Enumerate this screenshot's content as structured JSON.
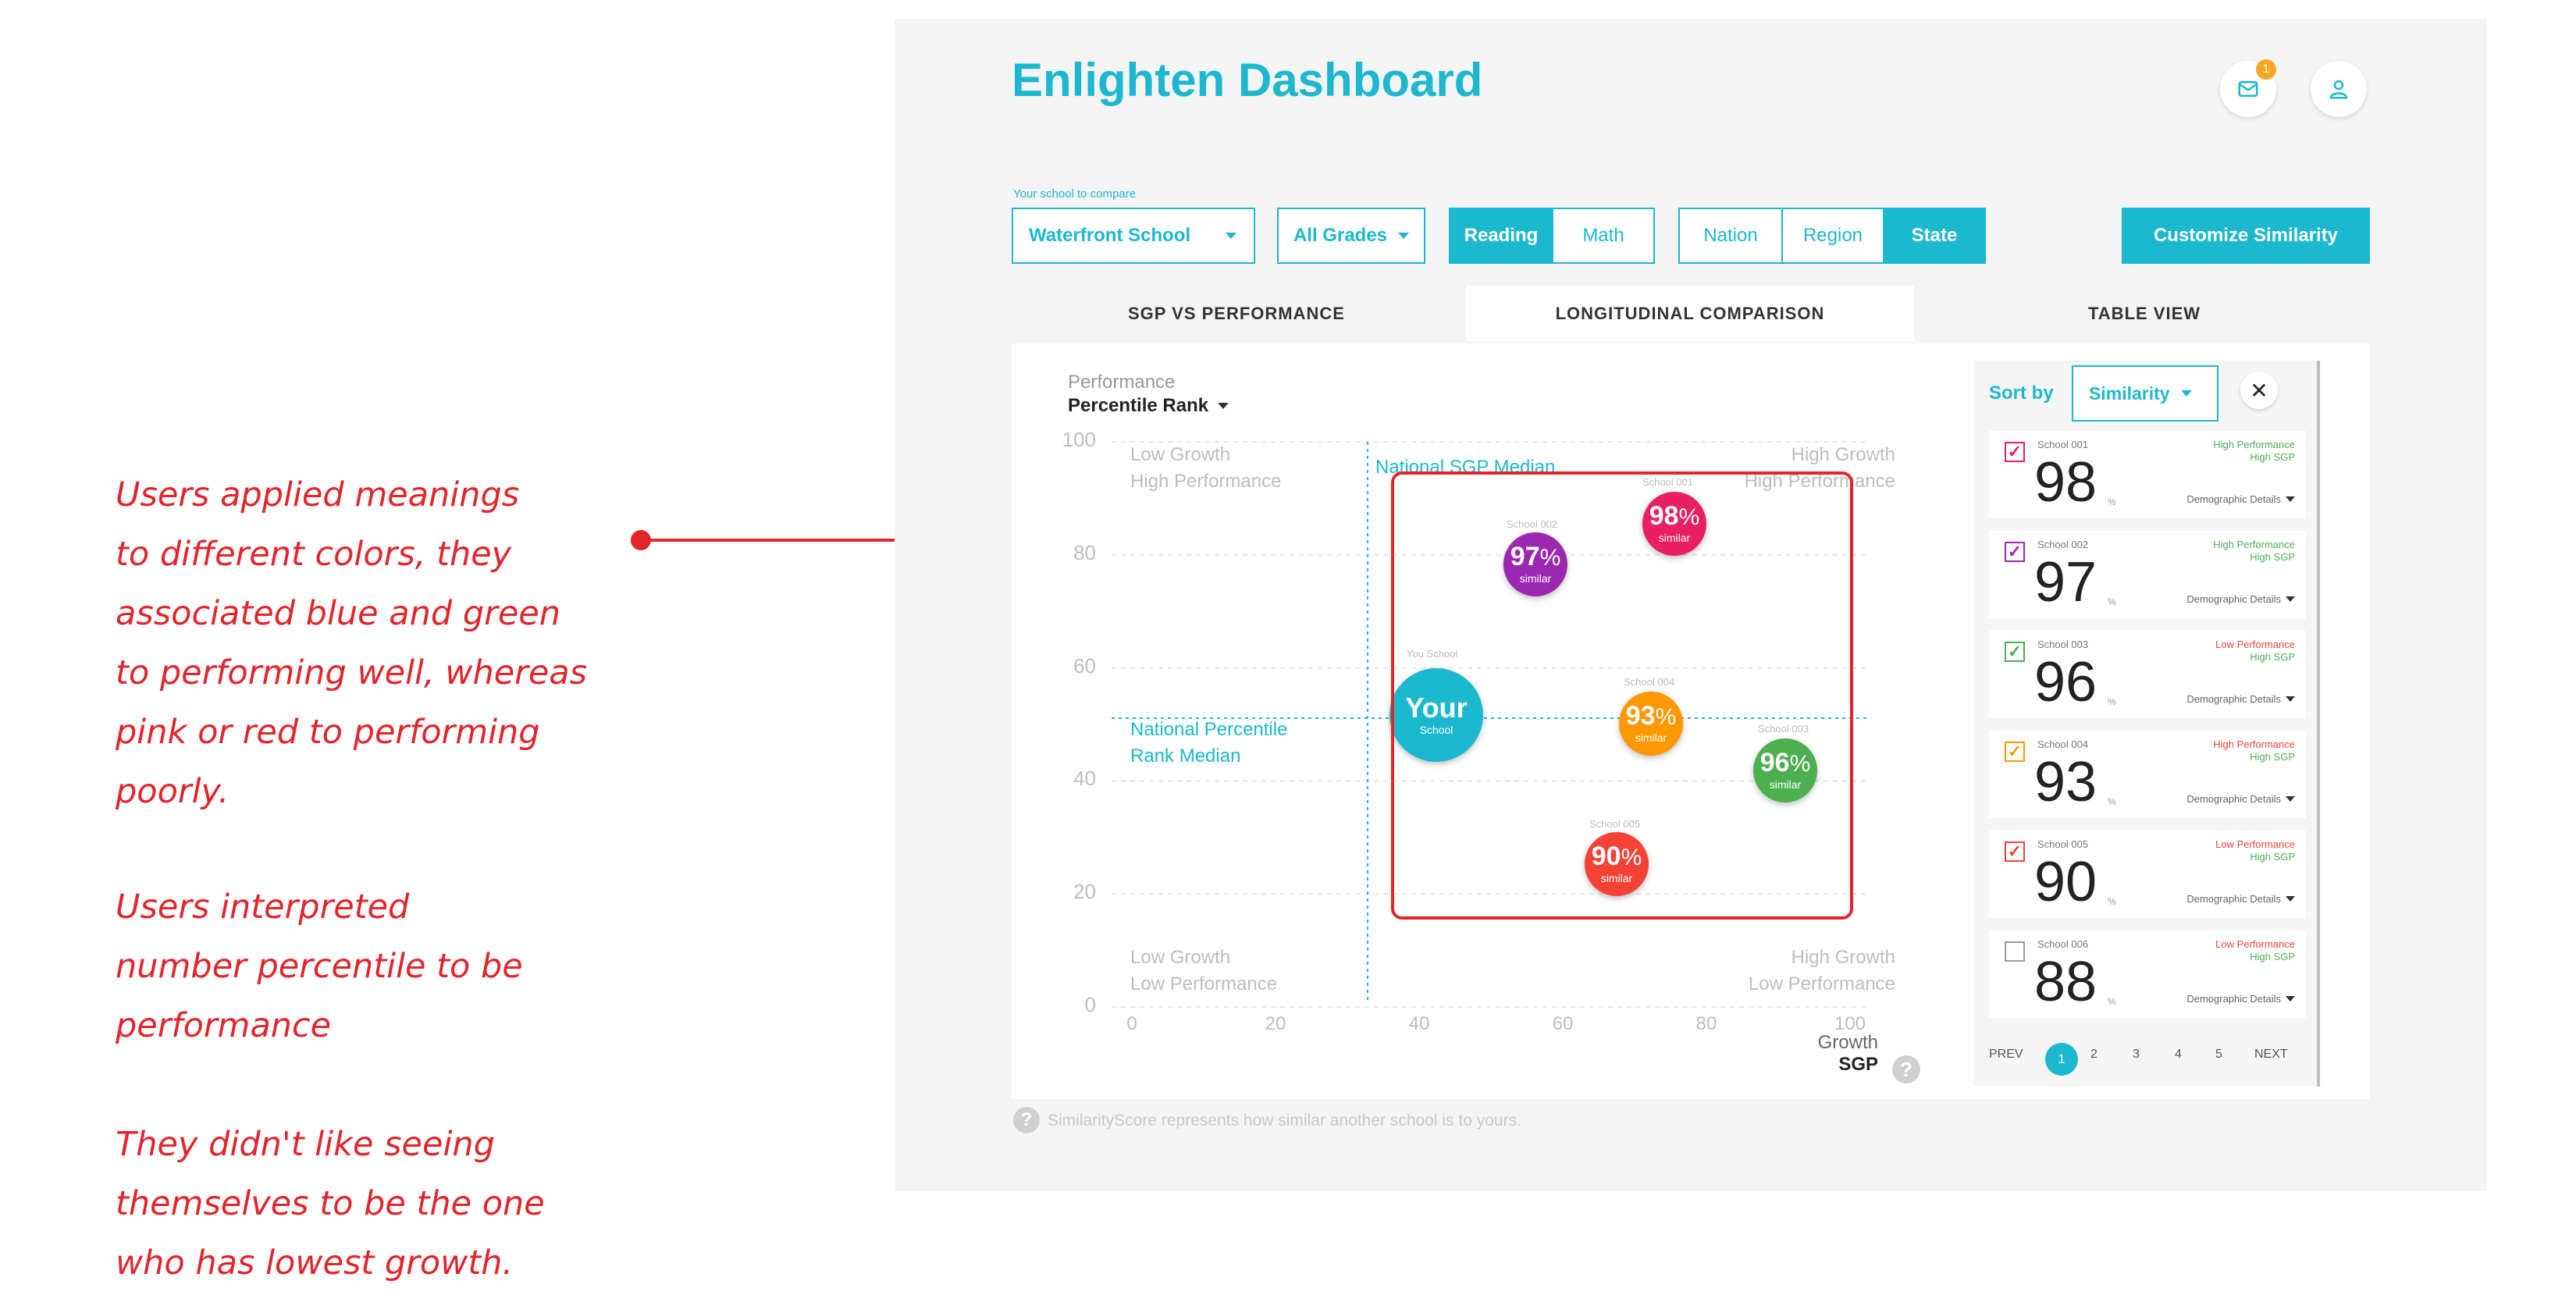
{
  "annotations": {
    "paragraph1": [
      "Users applied meanings",
      "to different colors, they",
      "associated blue and green",
      "to performing well, whereas",
      "pink or red to performing",
      "poorly."
    ],
    "paragraph2": [
      "Users interpreted",
      "number percentile to be",
      "performance"
    ],
    "paragraph3": [
      "They didn't like seeing",
      "themselves to be the one",
      "who has lowest growth."
    ]
  },
  "header": {
    "title": "Enlighten Dashboard",
    "mail_badge": "1",
    "mail_icon": "mail-icon",
    "user_icon": "user-icon"
  },
  "controls": {
    "school_label": "Your school to compare",
    "school_value": "Waterfront School",
    "grades_value": "All Grades",
    "subjects": [
      "Reading",
      "Math"
    ],
    "subject_selected": "Reading",
    "scopes": [
      "Nation",
      "Region",
      "State"
    ],
    "scope_selected": "State",
    "customize_label": "Customize Similarity"
  },
  "tabs": [
    "SGP VS PERFORMANCE",
    "LONGITUDINAL COMPARISON",
    "TABLE VIEW"
  ],
  "active_tab": "LONGITUDINAL COMPARISON",
  "chart": {
    "y_title_small": "Performance",
    "y_title": "Percentile Rank",
    "y_ticks": [
      "100",
      "80",
      "60",
      "40",
      "20",
      "0"
    ],
    "x_ticks": [
      "0",
      "20",
      "40",
      "60",
      "80",
      "100"
    ],
    "x_title_small": "Growth",
    "x_title": "SGP",
    "quadrants": {
      "top_left": [
        "Low Growth",
        "High Performance"
      ],
      "top_right": [
        "High Growth",
        "High Performance"
      ],
      "bottom_left": [
        "Low Growth",
        "Low Performance"
      ],
      "bottom_right": [
        "High Growth",
        "Low Performance"
      ]
    },
    "sgp_median_label": "National SGP Median",
    "rank_median_label": [
      "National Percentile",
      "Rank Median"
    ],
    "similar_label": "similar",
    "your_school": {
      "caption": "You School",
      "title": "Your",
      "sub": "School"
    },
    "schools": [
      {
        "name": "School 001",
        "similarity": "98",
        "color": "#e91e63"
      },
      {
        "name": "School 002",
        "similarity": "97",
        "color": "#9c27b0"
      },
      {
        "name": "School 004",
        "similarity": "93",
        "color": "#ff9800"
      },
      {
        "name": "School 003",
        "similarity": "96",
        "color": "#4caf50"
      },
      {
        "name": "School 005",
        "similarity": "90",
        "color": "#f44336"
      }
    ],
    "footnote": "SimilarityScore represents how similar another school is to yours."
  },
  "sidebar": {
    "sort_label": "Sort by",
    "sort_value": "Similarity",
    "close_icon": "close-icon",
    "demographic_label": "Demographic Details",
    "items": [
      {
        "name": "School 001",
        "score": "98",
        "perf": "High Performance",
        "perf_color": "#4caf50",
        "sgp": "High SGP",
        "checked": true,
        "check_color": "#e91e63"
      },
      {
        "name": "School 002",
        "score": "97",
        "perf": "High Performance",
        "perf_color": "#4caf50",
        "sgp": "High SGP",
        "checked": true,
        "check_color": "#9c27b0"
      },
      {
        "name": "School 003",
        "score": "96",
        "perf": "Low Performance",
        "perf_color": "#f44336",
        "sgp": "High SGP",
        "checked": true,
        "check_color": "#4caf50"
      },
      {
        "name": "School 004",
        "score": "93",
        "perf": "High Performance",
        "perf_color": "#f44336",
        "sgp": "High SGP",
        "checked": true,
        "check_color": "#ff9800"
      },
      {
        "name": "School 005",
        "score": "90",
        "perf": "Low Performance",
        "perf_color": "#f44336",
        "sgp": "High SGP",
        "checked": true,
        "check_color": "#f44336"
      },
      {
        "name": "School 006",
        "score": "88",
        "perf": "Low Performance",
        "perf_color": "#f44336",
        "sgp": "High SGP",
        "checked": false,
        "check_color": "#999999"
      }
    ],
    "pager": {
      "prev": "PREV",
      "next": "NEXT",
      "pages": [
        "1",
        "2",
        "3",
        "4",
        "5"
      ],
      "current": "1"
    }
  }
}
